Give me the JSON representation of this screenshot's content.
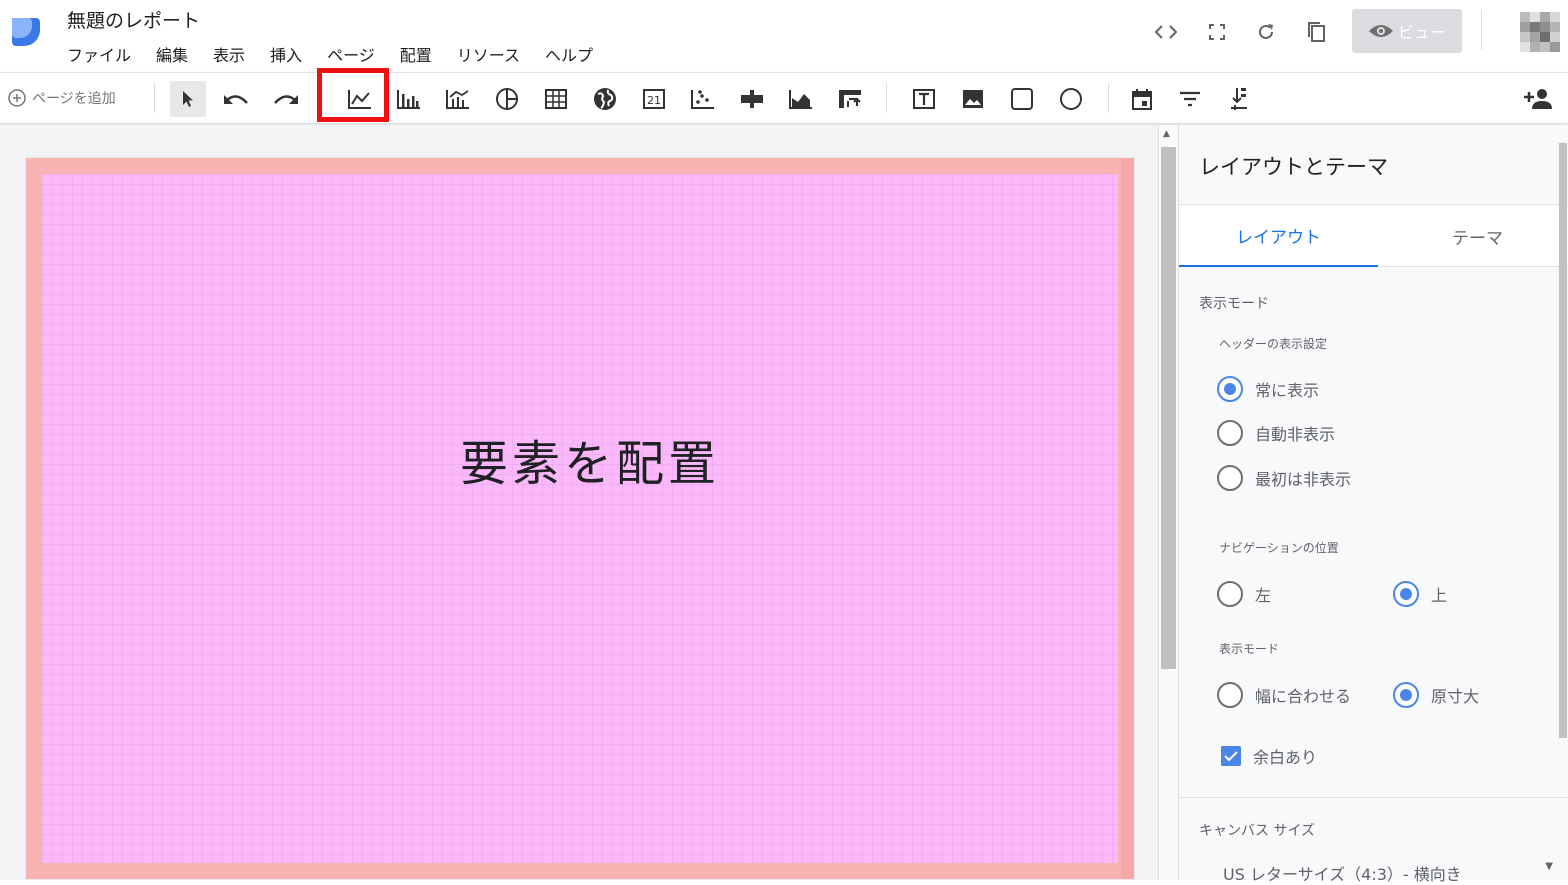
{
  "app": {
    "title": "無題のレポート",
    "menu": [
      "ファイル",
      "編集",
      "表示",
      "挿入",
      "ページ",
      "配置",
      "リソース",
      "ヘルプ"
    ],
    "view_button": "ビュー"
  },
  "toolbar": {
    "add_page": "ページを追加",
    "highlight_color": "#ee1111"
  },
  "canvas": {
    "placeholder": "要素を配置",
    "page_color": "#fbb8fb"
  },
  "panel": {
    "title": "レイアウトとテーマ",
    "tabs": [
      "レイアウト",
      "テーマ"
    ],
    "display_mode_section": "表示モード",
    "header_setting_label": "ヘッダーの表示設定",
    "header_options": [
      "常に表示",
      "自動非表示",
      "最初は非表示"
    ],
    "nav_position_label": "ナビゲーションの位置",
    "nav_options": [
      "左",
      "上"
    ],
    "display_mode_label": "表示モード",
    "display_mode_options": [
      "幅に合わせる",
      "原寸大"
    ],
    "margin_checkbox": "余白あり",
    "canvas_size_label": "キャンバス サイズ",
    "canvas_size_value": "US レターサイズ（4:3）- 横向き"
  }
}
